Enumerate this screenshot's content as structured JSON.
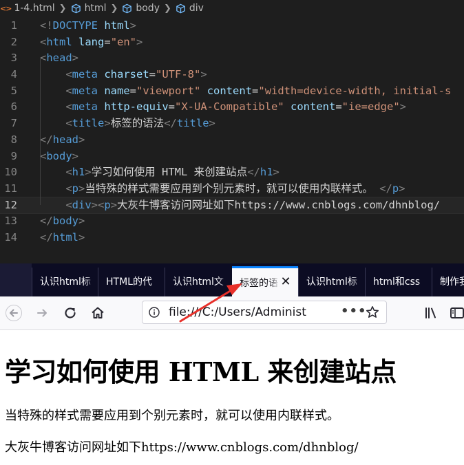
{
  "editor": {
    "breadcrumb": {
      "file_icon": "<>",
      "file": "1-4.html",
      "items": [
        "html",
        "body",
        "div"
      ]
    },
    "lines": [
      {
        "n": "1",
        "active": false,
        "tokens": [
          [
            "ab",
            "<!"
          ],
          [
            "tg",
            "DOCTYPE"
          ],
          [
            "pl",
            " "
          ],
          [
            "at",
            "html"
          ],
          [
            "ab",
            ">"
          ]
        ]
      },
      {
        "n": "2",
        "active": false,
        "tokens": [
          [
            "ab",
            "<"
          ],
          [
            "tg",
            "html"
          ],
          [
            "pl",
            " "
          ],
          [
            "at",
            "lang"
          ],
          [
            "pl",
            "="
          ],
          [
            "st",
            "\"en\""
          ],
          [
            "ab",
            ">"
          ]
        ]
      },
      {
        "n": "3",
        "active": false,
        "tokens": [
          [
            "ab",
            "<"
          ],
          [
            "tg",
            "head"
          ],
          [
            "ab",
            ">"
          ]
        ]
      },
      {
        "n": "4",
        "active": false,
        "tokens": [
          [
            "pl",
            "    "
          ],
          [
            "ab",
            "<"
          ],
          [
            "tg",
            "meta"
          ],
          [
            "pl",
            " "
          ],
          [
            "at",
            "charset"
          ],
          [
            "pl",
            "="
          ],
          [
            "st",
            "\"UTF-8\""
          ],
          [
            "ab",
            ">"
          ]
        ]
      },
      {
        "n": "5",
        "active": false,
        "tokens": [
          [
            "pl",
            "    "
          ],
          [
            "ab",
            "<"
          ],
          [
            "tg",
            "meta"
          ],
          [
            "pl",
            " "
          ],
          [
            "at",
            "name"
          ],
          [
            "pl",
            "="
          ],
          [
            "st",
            "\"viewport\""
          ],
          [
            "pl",
            " "
          ],
          [
            "at",
            "content"
          ],
          [
            "pl",
            "="
          ],
          [
            "st",
            "\"width=device-width, initial-s"
          ]
        ]
      },
      {
        "n": "6",
        "active": false,
        "tokens": [
          [
            "pl",
            "    "
          ],
          [
            "ab",
            "<"
          ],
          [
            "tg",
            "meta"
          ],
          [
            "pl",
            " "
          ],
          [
            "at",
            "http-equiv"
          ],
          [
            "pl",
            "="
          ],
          [
            "st",
            "\"X-UA-Compatible\""
          ],
          [
            "pl",
            " "
          ],
          [
            "at",
            "content"
          ],
          [
            "pl",
            "="
          ],
          [
            "st",
            "\"ie=edge\""
          ],
          [
            "ab",
            ">"
          ]
        ]
      },
      {
        "n": "7",
        "active": false,
        "tokens": [
          [
            "pl",
            "    "
          ],
          [
            "ab",
            "<"
          ],
          [
            "tg",
            "title"
          ],
          [
            "ab",
            ">"
          ],
          [
            "pl",
            "标签的语法"
          ],
          [
            "ab",
            "</"
          ],
          [
            "tg",
            "title"
          ],
          [
            "ab",
            ">"
          ]
        ]
      },
      {
        "n": "8",
        "active": false,
        "tokens": [
          [
            "ab",
            "</"
          ],
          [
            "tg",
            "head"
          ],
          [
            "ab",
            ">"
          ]
        ]
      },
      {
        "n": "9",
        "active": false,
        "tokens": [
          [
            "ab",
            "<"
          ],
          [
            "tg",
            "body"
          ],
          [
            "ab",
            ">"
          ]
        ]
      },
      {
        "n": "10",
        "active": false,
        "tokens": [
          [
            "pl",
            "    "
          ],
          [
            "ab",
            "<"
          ],
          [
            "tg",
            "h1"
          ],
          [
            "ab",
            ">"
          ],
          [
            "pl",
            "学习如何使用 HTML 来创建站点"
          ],
          [
            "ab",
            "</"
          ],
          [
            "tg",
            "h1"
          ],
          [
            "ab",
            ">"
          ]
        ]
      },
      {
        "n": "11",
        "active": false,
        "tokens": [
          [
            "pl",
            "    "
          ],
          [
            "ab",
            "<"
          ],
          [
            "tg",
            "p"
          ],
          [
            "ab",
            ">"
          ],
          [
            "pl",
            "当特殊的样式需要应用到个别元素时，就可以使用内联样式。 "
          ],
          [
            "ab",
            "</"
          ],
          [
            "tg",
            "p"
          ],
          [
            "ab",
            ">"
          ]
        ]
      },
      {
        "n": "12",
        "active": true,
        "tokens": [
          [
            "pl",
            "    "
          ],
          [
            "ab",
            "<"
          ],
          [
            "tg",
            "div"
          ],
          [
            "ab",
            "><"
          ],
          [
            "tg",
            "p"
          ],
          [
            "ab",
            ">"
          ],
          [
            "pl",
            "大灰牛博客访问网址如下https://www.cnblogs.com/dhnblog/"
          ]
        ]
      },
      {
        "n": "13",
        "active": false,
        "tokens": [
          [
            "ab",
            "</"
          ],
          [
            "tg",
            "body"
          ],
          [
            "ab",
            ">"
          ]
        ]
      },
      {
        "n": "14",
        "active": false,
        "tokens": [
          [
            "ab",
            "</"
          ],
          [
            "tg",
            "html"
          ],
          [
            "ab",
            ">"
          ]
        ]
      }
    ]
  },
  "browser": {
    "tabs": [
      {
        "label": "认识html标",
        "active": false
      },
      {
        "label": "HTML的代",
        "active": false
      },
      {
        "label": "认识html文",
        "active": false
      },
      {
        "label": "标签的语法",
        "active": true
      },
      {
        "label": "认识html标",
        "active": false
      },
      {
        "label": "html和css",
        "active": false
      },
      {
        "label": "制作我",
        "active": false
      }
    ],
    "url": "file:///C:/Users/Administrator",
    "icons": [
      "back-icon",
      "forward-icon",
      "reload-icon",
      "home-icon",
      "info-icon",
      "page-actions-icon",
      "bookmark-star-icon",
      "library-icon",
      "sidebar-icon",
      "tab-close-icon"
    ]
  },
  "page": {
    "h1": "学习如何使用 HTML 来创建站点",
    "p1": "当特殊的样式需要应用到个别元素时，就可以使用内联样式。",
    "p2": "大灰牛博客访问网址如下https://www.cnblogs.com/dhnblog/"
  },
  "colors": {
    "editor_bg": "#1e1e1e",
    "tag": "#569cd6",
    "attribute": "#9cdcfe",
    "string": "#ce9178",
    "bracket": "#808080",
    "tab_accent": "#0a84ff",
    "annotation_arrow": "#e8302a"
  }
}
